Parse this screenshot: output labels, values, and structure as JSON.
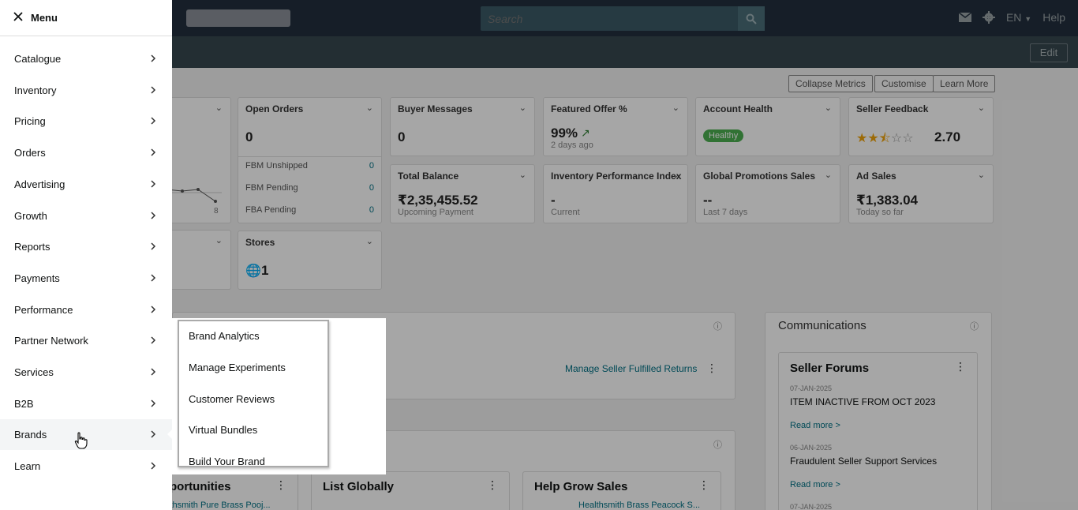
{
  "header": {
    "search_placeholder": "Search",
    "language": "EN",
    "help": "Help",
    "edit": "Edit"
  },
  "dashboard": {
    "buttons": [
      "Collapse Metrics",
      "Customise",
      "Learn More"
    ],
    "open_orders": {
      "title": "Open Orders",
      "value": "0",
      "rows": [
        {
          "label": "FBM Unshipped",
          "value": "0"
        },
        {
          "label": "FBM Pending",
          "value": "0"
        },
        {
          "label": "FBA Pending",
          "value": "0"
        }
      ]
    },
    "buyer_messages": {
      "title": "Buyer Messages",
      "value": "0"
    },
    "featured_offer": {
      "title": "Featured Offer %",
      "value": "99%",
      "sub": "2 days ago"
    },
    "account_health": {
      "title": "Account Health",
      "badge": "Healthy"
    },
    "seller_feedback": {
      "title": "Seller Feedback",
      "value": "2.70",
      "rating": 2.5
    },
    "total_balance": {
      "title": "Total Balance",
      "value": "₹2,35,455.52",
      "sub": "Upcoming Payment"
    },
    "ipi": {
      "title": "Inventory Performance Index",
      "value": "-",
      "sub": "Current"
    },
    "global_promotions": {
      "title": "Global Promotions Sales",
      "value": "--",
      "sub": "Last 7 days"
    },
    "ad_sales": {
      "title": "Ad Sales",
      "value": "₹1,383.04",
      "sub": "Today so far"
    },
    "stores": {
      "title": "Stores",
      "value": "1"
    },
    "chart_tick": "8",
    "manage_returns": "Manage Seller Fulfilled Returns",
    "communications": {
      "title": "Communications",
      "forums_title": "Seller Forums",
      "posts": [
        {
          "date": "07-JAN-2025",
          "title": "ITEM INACTIVE FROM OCT 2023",
          "link": "Read more >"
        },
        {
          "date": "06-JAN-2025",
          "title": "Fraudulent Seller Support Services",
          "link": "Read more >"
        },
        {
          "date": "07-JAN-2025"
        }
      ]
    },
    "bottom_cards": [
      {
        "title": "portunities",
        "sub": "lthsmith Pure Brass Pooj..."
      },
      {
        "title": "List Globally"
      },
      {
        "title": "Help Grow Sales",
        "sub": "Healthsmith Brass Peacock S..."
      }
    ]
  },
  "menu": {
    "title": "Menu",
    "items": [
      "Catalogue",
      "Inventory",
      "Pricing",
      "Orders",
      "Advertising",
      "Growth",
      "Reports",
      "Payments",
      "Performance",
      "Partner Network",
      "Services",
      "B2B",
      "Brands",
      "Learn"
    ],
    "active": "Brands"
  },
  "brands_flyout": {
    "items": [
      "Brand Analytics",
      "Manage Experiments",
      "Customer Reviews",
      "Virtual Bundles",
      "Build Your Brand"
    ]
  }
}
